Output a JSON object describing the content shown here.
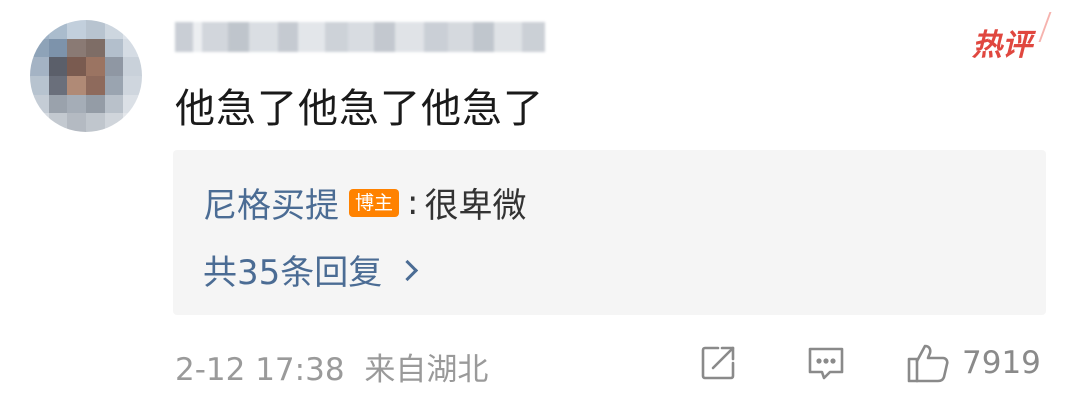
{
  "comment": {
    "badge": "热评",
    "text": "他急了他急了他急了"
  },
  "reply": {
    "user": "尼格买提",
    "user_badge": "博主",
    "colon": ":",
    "content": "很卑微",
    "count_label": "共35条回复"
  },
  "footer": {
    "time": "2-12 17:38",
    "location": "来自湖北",
    "like_count": "7919"
  },
  "icons": {
    "share": "share-icon",
    "comment": "comment-icon",
    "like": "thumbs-up-icon"
  },
  "colors": {
    "link": "#4b6c94",
    "badge_orange": "#ff8200",
    "hot_red": "#e0473f"
  }
}
